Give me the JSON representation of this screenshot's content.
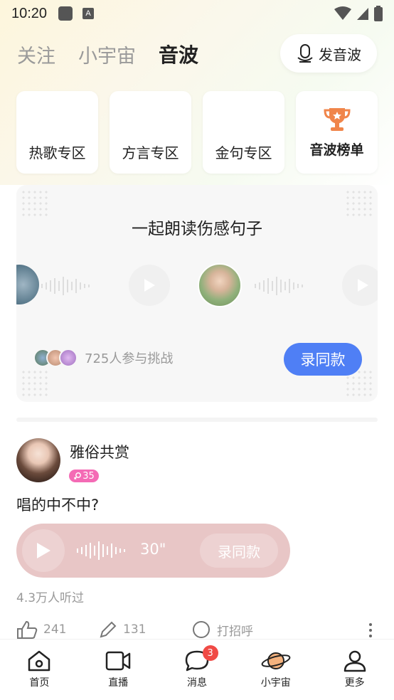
{
  "status_bar": {
    "time": "10:20",
    "app_indicator": "A"
  },
  "header": {
    "tabs": [
      {
        "label": "关注",
        "active": false
      },
      {
        "label": "小宇宙",
        "active": false
      },
      {
        "label": "音波",
        "active": true
      }
    ],
    "voice_button_label": "发音波"
  },
  "zones": [
    {
      "label": "热歌专区"
    },
    {
      "label": "方言专区"
    },
    {
      "label": "金句专区"
    },
    {
      "label": "音波榜单",
      "icon": "trophy-icon",
      "icon_color": "#f0854a"
    }
  ],
  "challenge": {
    "title": "一起朗读伤感句子",
    "participants_text": "725人参与挑战",
    "record_button": "录同款",
    "accent_color": "#4f7ff5"
  },
  "post": {
    "username": "雅俗共赏",
    "level": "35",
    "level_icon": "female-icon",
    "text": "唱的中不中?",
    "audio_duration": "30\"",
    "audio_record_label": "录同款",
    "listen_count": "4.3万人听过",
    "likes": "241",
    "comments": "131",
    "greet_label": "打招呼"
  },
  "bottom_nav": [
    {
      "label": "首页",
      "icon": "home-icon"
    },
    {
      "label": "直播",
      "icon": "video-icon"
    },
    {
      "label": "消息",
      "icon": "message-icon",
      "badge": "3"
    },
    {
      "label": "小宇宙",
      "icon": "planet-icon",
      "active": true
    },
    {
      "label": "更多",
      "icon": "person-icon"
    }
  ]
}
